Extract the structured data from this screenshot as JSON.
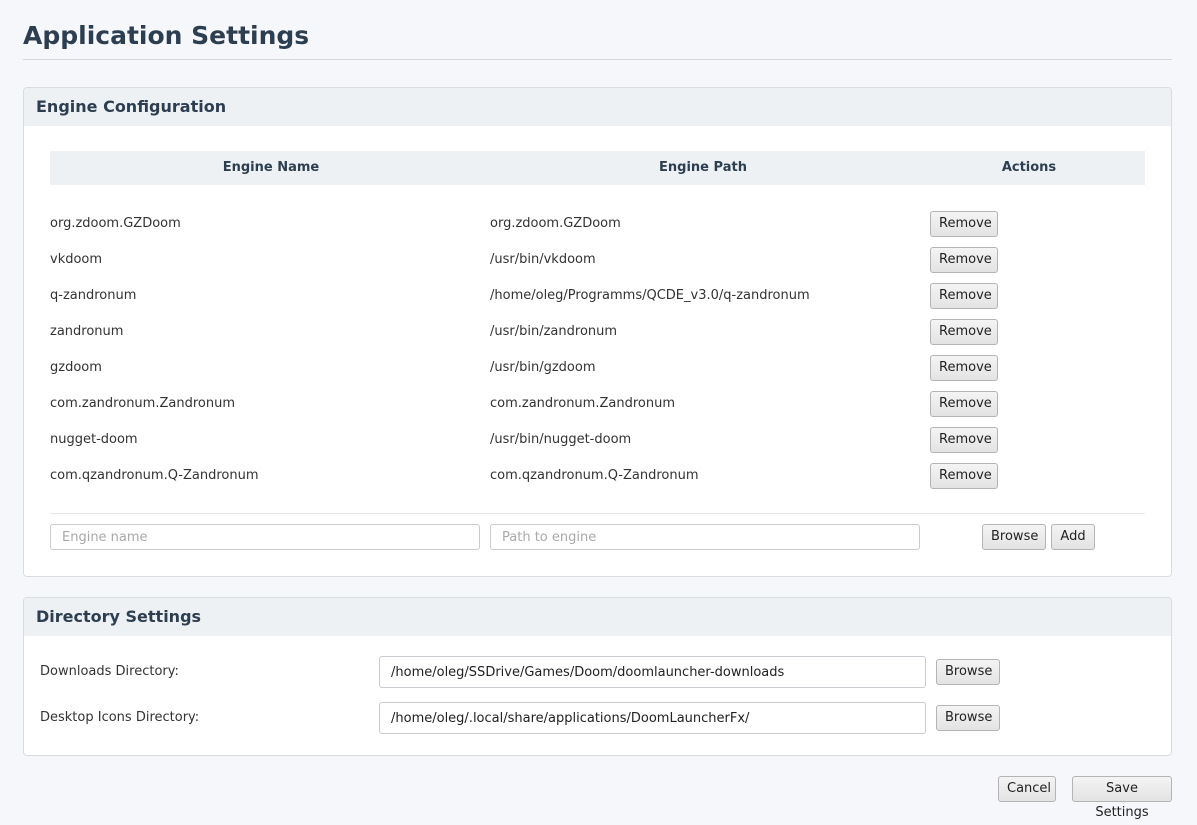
{
  "page": {
    "title": "Application Settings"
  },
  "engine_config": {
    "header": "Engine Configuration",
    "columns": {
      "name": "Engine Name",
      "path": "Engine Path",
      "actions": "Actions"
    },
    "rows": [
      {
        "name": "org.zdoom.GZDoom",
        "path": "org.zdoom.GZDoom",
        "action": "Remove"
      },
      {
        "name": "vkdoom",
        "path": "/usr/bin/vkdoom",
        "action": "Remove"
      },
      {
        "name": "q-zandronum",
        "path": "/home/oleg/Programms/QCDE_v3.0/q-zandronum",
        "action": "Remove"
      },
      {
        "name": "zandronum",
        "path": "/usr/bin/zandronum",
        "action": "Remove"
      },
      {
        "name": "gzdoom",
        "path": "/usr/bin/gzdoom",
        "action": "Remove"
      },
      {
        "name": "com.zandronum.Zandronum",
        "path": "com.zandronum.Zandronum",
        "action": "Remove"
      },
      {
        "name": "nugget-doom",
        "path": "/usr/bin/nugget-doom",
        "action": "Remove"
      },
      {
        "name": "com.qzandronum.Q-Zandronum",
        "path": "com.qzandronum.Q-Zandronum",
        "action": "Remove"
      }
    ],
    "new_engine": {
      "name_placeholder": "Engine name",
      "path_placeholder": "Path to engine",
      "browse_label": "Browse",
      "add_label": "Add"
    }
  },
  "directory_settings": {
    "header": "Directory Settings",
    "downloads": {
      "label": "Downloads Directory:",
      "value": "/home/oleg/SSDrive/Games/Doom/doomlauncher-downloads",
      "browse_label": "Browse"
    },
    "desktop_icons": {
      "label": "Desktop Icons Directory:",
      "value": "/home/oleg/.local/share/applications/DoomLauncherFx/",
      "browse_label": "Browse"
    }
  },
  "footer": {
    "cancel_label": "Cancel",
    "save_label": "Save Settings"
  }
}
